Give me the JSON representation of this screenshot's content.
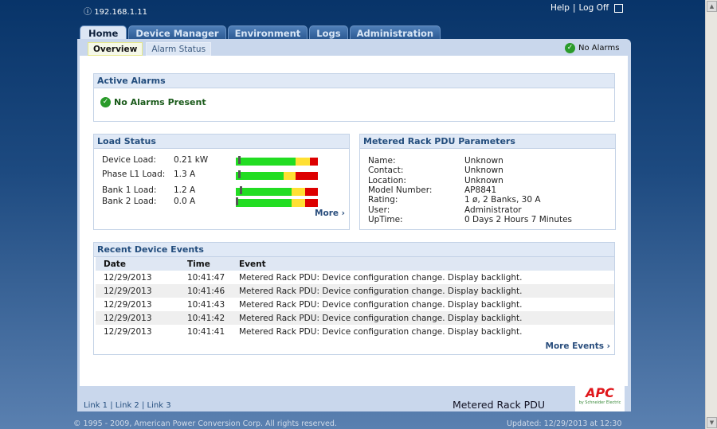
{
  "header": {
    "ip": "192.168.1.11",
    "help": "Help",
    "logoff": "Log Off"
  },
  "tabs": [
    "Home",
    "Device Manager",
    "Environment",
    "Logs",
    "Administration"
  ],
  "active_tab": "Home",
  "subtabs": [
    "Overview",
    "Alarm Status"
  ],
  "alarm_indicator": "No Alarms",
  "active_alarms": {
    "title": "Active Alarms",
    "message": "No Alarms Present"
  },
  "load_status": {
    "title": "Load Status",
    "more": "More ›",
    "rows": [
      {
        "label": "Device Load:",
        "value": "0.21 kW",
        "level": 0.03,
        "green": 0.73,
        "yellow": 0.17,
        "red": 0.1
      },
      {
        "label": "Phase L1 Load:",
        "value": "1.3 A",
        "level": 0.03,
        "green": 0.58,
        "yellow": 0.15,
        "red": 0.27
      },
      {
        "label": "Bank 1 Load:",
        "value": "1.2 A",
        "level": 0.05,
        "green": 0.68,
        "yellow": 0.16,
        "red": 0.16
      },
      {
        "label": "Bank 2 Load:",
        "value": "0.0 A",
        "level": 0.0,
        "green": 0.68,
        "yellow": 0.16,
        "red": 0.16
      }
    ]
  },
  "params": {
    "title": "Metered Rack PDU Parameters",
    "rows": [
      {
        "k": "Name:",
        "v": "Unknown"
      },
      {
        "k": "Contact:",
        "v": "Unknown"
      },
      {
        "k": "Location:",
        "v": "Unknown"
      },
      {
        "k": "Model Number:",
        "v": "AP8841"
      },
      {
        "k": "Rating:",
        "v": "1 ø, 2 Banks, 30 A"
      },
      {
        "k": "User:",
        "v": "Administrator"
      },
      {
        "k": "UpTime:",
        "v": "0 Days 2 Hours 7 Minutes"
      }
    ]
  },
  "events": {
    "title": "Recent Device Events",
    "columns": [
      "Date",
      "Time",
      "Event"
    ],
    "more": "More Events ›",
    "rows": [
      [
        "12/29/2013",
        "10:41:47",
        "Metered Rack PDU: Device configuration change. Display backlight."
      ],
      [
        "12/29/2013",
        "10:41:46",
        "Metered Rack PDU: Device configuration change. Display backlight."
      ],
      [
        "12/29/2013",
        "10:41:43",
        "Metered Rack PDU: Device configuration change. Display backlight."
      ],
      [
        "12/29/2013",
        "10:41:42",
        "Metered Rack PDU: Device configuration change. Display backlight."
      ],
      [
        "12/29/2013",
        "10:41:41",
        "Metered Rack PDU: Device configuration change. Display backlight."
      ]
    ]
  },
  "footer": {
    "links": [
      "Link 1",
      "Link 2",
      "Link 3"
    ],
    "product": "Metered Rack PDU",
    "logo": "APC",
    "logo_sub": "by Schneider Electric",
    "copyright": "© 1995 - 2009, American Power Conversion Corp. All rights reserved.",
    "updated": "Updated: 12/29/2013 at 12:30"
  },
  "colors": {
    "green": "#22dd22",
    "yellow": "#ffe033",
    "red": "#dd0000",
    "header_bg": "#083469"
  }
}
